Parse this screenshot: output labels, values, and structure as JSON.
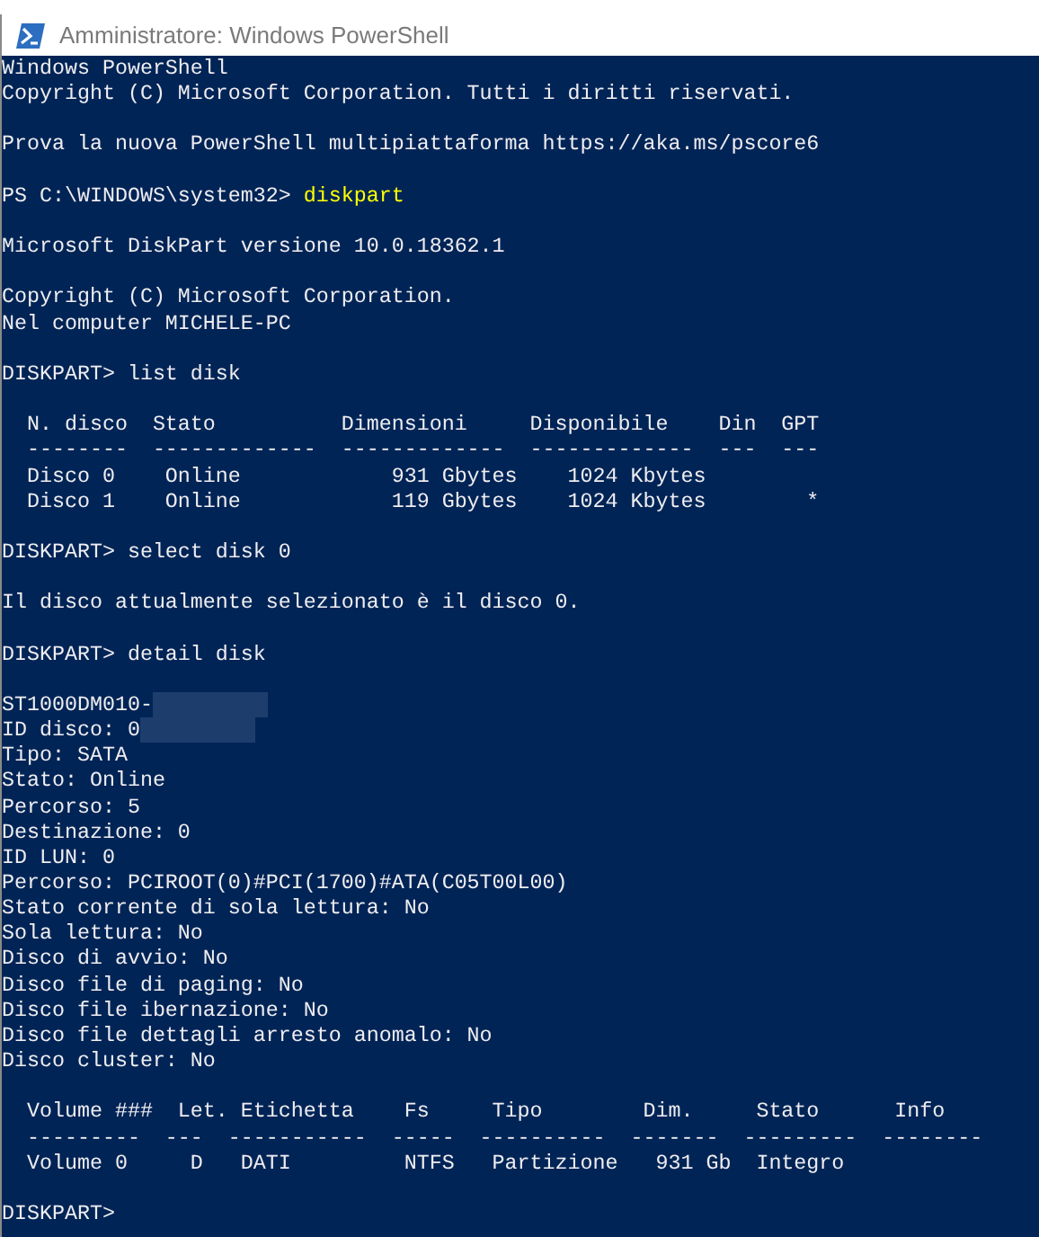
{
  "window": {
    "title": "Amministratore: Windows PowerShell"
  },
  "console": {
    "lines": [
      {
        "kind": "output",
        "text": "Windows PowerShell"
      },
      {
        "kind": "output",
        "text": "Copyright (C) Microsoft Corporation. Tutti i diritti riservati."
      },
      {
        "kind": "blank"
      },
      {
        "kind": "output",
        "text": "Prova la nuova PowerShell multipiattaforma https://aka.ms/pscore6"
      },
      {
        "kind": "blank"
      },
      {
        "kind": "ps_command",
        "prompt": "PS C:\\WINDOWS\\system32> ",
        "command": "diskpart"
      },
      {
        "kind": "blank"
      },
      {
        "kind": "output",
        "text": "Microsoft DiskPart versione 10.0.18362.1"
      },
      {
        "kind": "blank"
      },
      {
        "kind": "output",
        "text": "Copyright (C) Microsoft Corporation."
      },
      {
        "kind": "output",
        "text": "Nel computer MICHELE-PC"
      },
      {
        "kind": "blank"
      },
      {
        "kind": "output",
        "text": "DISKPART> list disk"
      },
      {
        "kind": "blank"
      },
      {
        "kind": "output",
        "text": "  N. disco  Stato          Dimensioni     Disponibile    Din  GPT"
      },
      {
        "kind": "output",
        "text": "  --------  -------------  -------------  -------------  ---  ---"
      },
      {
        "kind": "output",
        "text": "  Disco 0    Online            931 Gbytes    1024 Kbytes"
      },
      {
        "kind": "output",
        "text": "  Disco 1    Online            119 Gbytes    1024 Kbytes        *"
      },
      {
        "kind": "blank"
      },
      {
        "kind": "output",
        "text": "DISKPART> select disk 0"
      },
      {
        "kind": "blank"
      },
      {
        "kind": "output",
        "text": "Il disco attualmente selezionato è il disco 0."
      },
      {
        "kind": "blank"
      },
      {
        "kind": "output",
        "text": "DISKPART> detail disk"
      },
      {
        "kind": "blank"
      },
      {
        "kind": "redacted",
        "text": "ST1000DM010-"
      },
      {
        "kind": "redacted",
        "text": "ID disco: 0"
      },
      {
        "kind": "output",
        "text": "Tipo: SATA"
      },
      {
        "kind": "output",
        "text": "Stato: Online"
      },
      {
        "kind": "output",
        "text": "Percorso: 5"
      },
      {
        "kind": "output",
        "text": "Destinazione: 0"
      },
      {
        "kind": "output",
        "text": "ID LUN: 0"
      },
      {
        "kind": "output",
        "text": "Percorso: PCIROOT(0)#PCI(1700)#ATA(C05T00L00)"
      },
      {
        "kind": "output",
        "text": "Stato corrente di sola lettura: No"
      },
      {
        "kind": "output",
        "text": "Sola lettura: No"
      },
      {
        "kind": "output",
        "text": "Disco di avvio: No"
      },
      {
        "kind": "output",
        "text": "Disco file di paging: No"
      },
      {
        "kind": "output",
        "text": "Disco file ibernazione: No"
      },
      {
        "kind": "output",
        "text": "Disco file dettagli arresto anomalo: No"
      },
      {
        "kind": "output",
        "text": "Disco cluster: No"
      },
      {
        "kind": "blank"
      },
      {
        "kind": "output",
        "text": "  Volume ###  Let. Etichetta    Fs     Tipo        Dim.     Stato      Info"
      },
      {
        "kind": "output",
        "text": "  ---------  ---  -----------  -----  ----------  -------  ---------  --------"
      },
      {
        "kind": "output",
        "text": "  Volume 0     D   DATI         NTFS   Partizione   931 Gb  Integro"
      },
      {
        "kind": "blank"
      },
      {
        "kind": "output",
        "text": "DISKPART>"
      }
    ]
  }
}
